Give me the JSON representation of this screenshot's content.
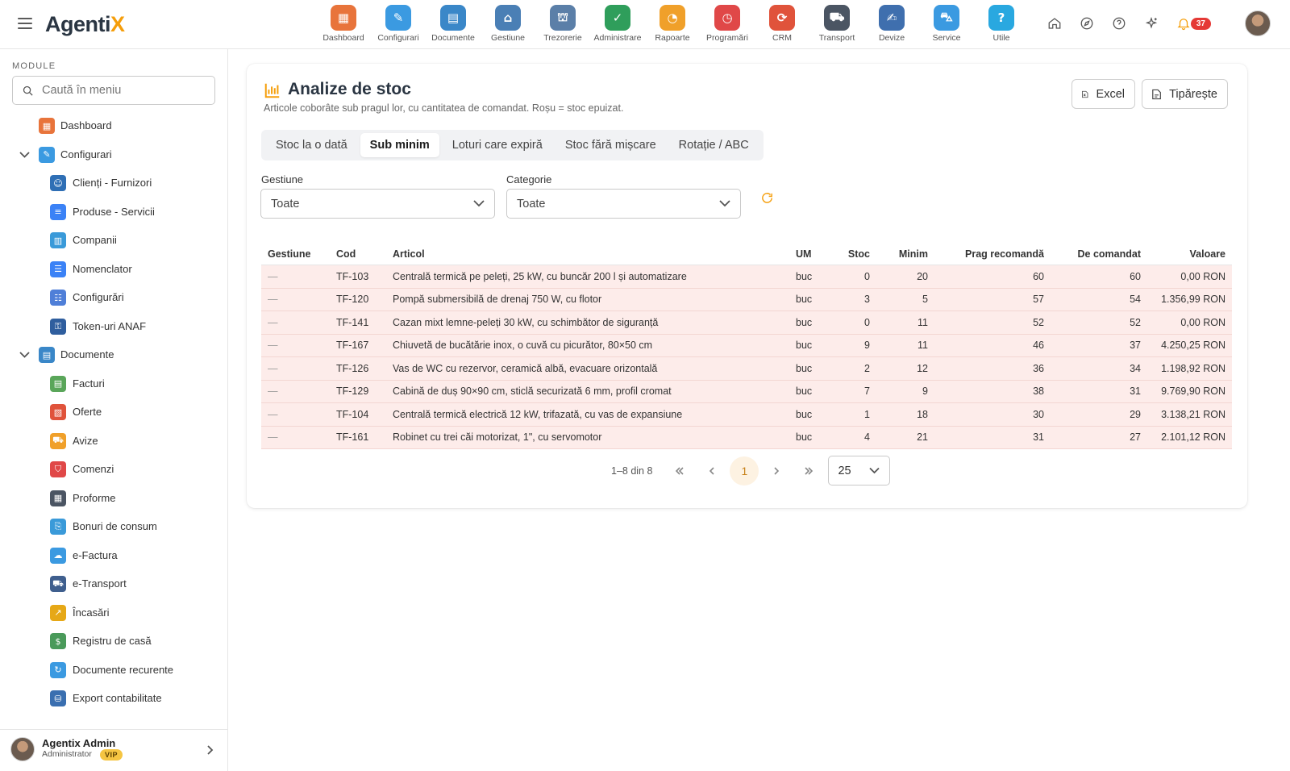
{
  "app": {
    "logo_main": "Agenti",
    "logo_accent": "X",
    "notifications_count": "37"
  },
  "topnav": [
    {
      "label": "Dashboard",
      "icon": "dashboard-icon",
      "color": "#e8743b",
      "glyph": "▦"
    },
    {
      "label": "Configurari",
      "icon": "wrench-icon",
      "color": "#3b9ae1",
      "glyph": "✎"
    },
    {
      "label": "Documente",
      "icon": "folder-icon",
      "color": "#3a87c8",
      "glyph": "▤"
    },
    {
      "label": "Gestiune",
      "icon": "warehouse-icon",
      "color": "#4a7fb5",
      "glyph": "⌂"
    },
    {
      "label": "Trezorerie",
      "icon": "bank-icon",
      "color": "#5b7fa8",
      "glyph": "⛫"
    },
    {
      "label": "Administrare",
      "icon": "shield-icon",
      "color": "#2f9e5b",
      "glyph": "✓"
    },
    {
      "label": "Rapoarte",
      "icon": "report-icon",
      "color": "#f0a02a",
      "glyph": "◔"
    },
    {
      "label": "Programări",
      "icon": "clock-icon",
      "color": "#e04848",
      "glyph": "◷"
    },
    {
      "label": "CRM",
      "icon": "crm-icon",
      "color": "#e0533b",
      "glyph": "⟳"
    },
    {
      "label": "Transport",
      "icon": "truck-icon",
      "color": "#4b5563",
      "glyph": "⛟"
    },
    {
      "label": "Devize",
      "icon": "document-pen-icon",
      "color": "#3f6fae",
      "glyph": "✍"
    },
    {
      "label": "Service",
      "icon": "car-icon",
      "color": "#3b9ae1",
      "glyph": "⛍"
    },
    {
      "label": "Utile",
      "icon": "help-icon",
      "color": "#29a8e0",
      "glyph": "?"
    }
  ],
  "sidebar": {
    "section_label": "MODULE",
    "search_placeholder": "Caută în meniu",
    "items": [
      {
        "label": "Dashboard",
        "level": 0,
        "icon": "dashboard-icon",
        "color": "#e8743b",
        "glyph": "▦",
        "expandable": false
      },
      {
        "label": "Configurari",
        "level": 0,
        "icon": "wrench-icon",
        "color": "#3b9ae1",
        "glyph": "✎",
        "expandable": true
      },
      {
        "label": "Clienți - Furnizori",
        "level": 1,
        "icon": "people-icon",
        "color": "#2f6fb5",
        "glyph": "☺"
      },
      {
        "label": "Produse - Servicii",
        "level": 1,
        "icon": "list-icon",
        "color": "#3b82f6",
        "glyph": "≡"
      },
      {
        "label": "Companii",
        "level": 1,
        "icon": "building-icon",
        "color": "#3a9ad9",
        "glyph": "▥"
      },
      {
        "label": "Nomenclator",
        "level": 1,
        "icon": "bullet-list-icon",
        "color": "#3b82f6",
        "glyph": "☰"
      },
      {
        "label": "Configurări",
        "level": 1,
        "icon": "settings-list-icon",
        "color": "#4f7fd8",
        "glyph": "☷"
      },
      {
        "label": "Token-uri ANAF",
        "level": 1,
        "icon": "lock-shield-icon",
        "color": "#2f5e9e",
        "glyph": "⚿"
      },
      {
        "label": "Documente",
        "level": 0,
        "icon": "folder-icon",
        "color": "#3a87c8",
        "glyph": "▤",
        "expandable": true
      },
      {
        "label": "Facturi",
        "level": 1,
        "icon": "invoice-icon",
        "color": "#5aa65a",
        "glyph": "▤"
      },
      {
        "label": "Oferte",
        "level": 1,
        "icon": "offer-icon",
        "color": "#e0533b",
        "glyph": "▧"
      },
      {
        "label": "Avize",
        "level": 1,
        "icon": "delivery-truck-icon",
        "color": "#f0a02a",
        "glyph": "⛟"
      },
      {
        "label": "Comenzi",
        "level": 1,
        "icon": "cart-icon",
        "color": "#e04848",
        "glyph": "⛉"
      },
      {
        "label": "Proforme",
        "level": 1,
        "icon": "calculator-icon",
        "color": "#4b5563",
        "glyph": "▦"
      },
      {
        "label": "Bonuri de consum",
        "level": 1,
        "icon": "receipt-icon",
        "color": "#3a9ad9",
        "glyph": "⎘"
      },
      {
        "label": "e-Factura",
        "level": 1,
        "icon": "cloud-icon",
        "color": "#3b9ae1",
        "glyph": "☁"
      },
      {
        "label": "e-Transport",
        "level": 1,
        "icon": "truck-icon",
        "color": "#3f5f8e",
        "glyph": "⛟"
      },
      {
        "label": "Încasări",
        "level": 1,
        "icon": "chart-up-icon",
        "color": "#e6a817",
        "glyph": "↗"
      },
      {
        "label": "Registru de casă",
        "level": 1,
        "icon": "cash-register-icon",
        "color": "#4a9a5a",
        "glyph": "$"
      },
      {
        "label": "Documente recurente",
        "level": 1,
        "icon": "recurring-icon",
        "color": "#3b9ae1",
        "glyph": "↻"
      },
      {
        "label": "Export contabilitate",
        "level": 1,
        "icon": "database-export-icon",
        "color": "#3a6fb0",
        "glyph": "⛁"
      }
    ],
    "user": {
      "name": "Agentix Admin",
      "role": "Administrator",
      "badge": "VIP"
    }
  },
  "page": {
    "title": "Analize de stoc",
    "subtitle": "Articole coborâte sub pragul lor, cu cantitatea de comandat. Roșu = stoc epuizat.",
    "excel_label": "Excel",
    "print_label": "Tipărește",
    "tabs": [
      {
        "label": "Stoc la o dată",
        "active": false
      },
      {
        "label": "Sub minim",
        "active": true
      },
      {
        "label": "Loturi care expiră",
        "active": false
      },
      {
        "label": "Stoc fără mișcare",
        "active": false
      },
      {
        "label": "Rotație / ABC",
        "active": false
      }
    ],
    "filters": {
      "gestiune_label": "Gestiune",
      "gestiune_value": "Toate",
      "categorie_label": "Categorie",
      "categorie_value": "Toate"
    },
    "table": {
      "columns": [
        "Gestiune",
        "Cod",
        "Articol",
        "UM",
        "Stoc",
        "Minim",
        "Prag recomandă",
        "De comandat",
        "Valoare"
      ],
      "rows": [
        [
          "—",
          "TF-103",
          "Centrală termică pe peleți, 25 kW, cu buncăr 200 l și automatizare",
          "buc",
          "0",
          "20",
          "60",
          "60",
          "0,00 RON"
        ],
        [
          "—",
          "TF-120",
          "Pompă submersibilă de drenaj 750 W, cu flotor",
          "buc",
          "3",
          "5",
          "57",
          "54",
          "1.356,99 RON"
        ],
        [
          "—",
          "TF-141",
          "Cazan mixt lemne-peleți 30 kW, cu schimbător de siguranță",
          "buc",
          "0",
          "11",
          "52",
          "52",
          "0,00 RON"
        ],
        [
          "—",
          "TF-167",
          "Chiuvetă de bucătărie inox, o cuvă cu picurător, 80×50 cm",
          "buc",
          "9",
          "11",
          "46",
          "37",
          "4.250,25 RON"
        ],
        [
          "—",
          "TF-126",
          "Vas de WC cu rezervor, ceramică albă, evacuare orizontală",
          "buc",
          "2",
          "12",
          "36",
          "34",
          "1.198,92 RON"
        ],
        [
          "—",
          "TF-129",
          "Cabină de duș 90×90 cm, sticlă securizată 6 mm, profil cromat",
          "buc",
          "7",
          "9",
          "38",
          "31",
          "9.769,90 RON"
        ],
        [
          "—",
          "TF-104",
          "Centrală termică electrică 12 kW, trifazată, cu vas de expansiune",
          "buc",
          "1",
          "18",
          "30",
          "29",
          "3.138,21 RON"
        ],
        [
          "—",
          "TF-161",
          "Robinet cu trei căi motorizat, 1\", cu servomotor",
          "buc",
          "4",
          "21",
          "31",
          "27",
          "2.101,12 RON"
        ]
      ]
    },
    "pagination": {
      "info": "1–8 din 8",
      "current_page": "1",
      "page_size": "25"
    }
  }
}
